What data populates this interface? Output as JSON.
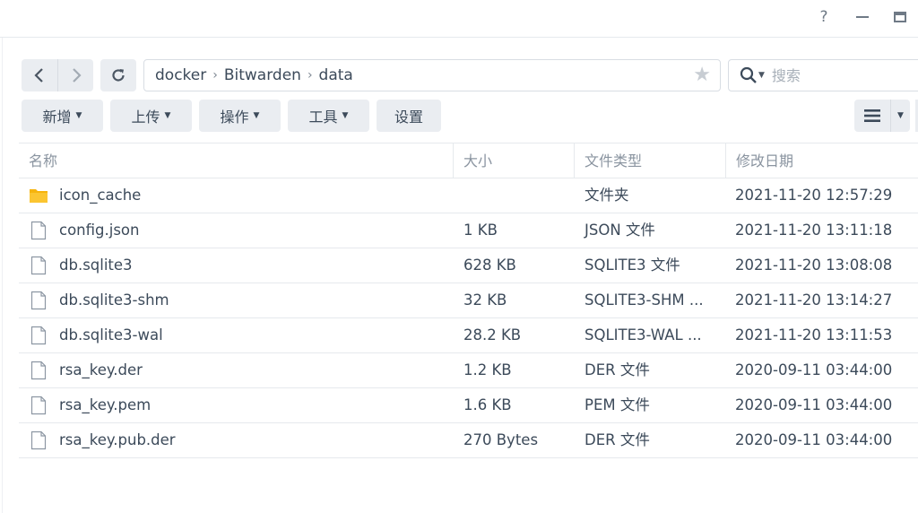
{
  "window": {
    "help_glyph": "?",
    "icons": [
      "help-icon",
      "minimize-icon",
      "maximize-icon"
    ]
  },
  "path": {
    "crumbs": [
      "docker",
      "Bitwarden",
      "data"
    ]
  },
  "search": {
    "placeholder": "搜索"
  },
  "actions": {
    "new_label": "新增",
    "upload_label": "上传",
    "operate_label": "操作",
    "tools_label": "工具",
    "settings_label": "设置"
  },
  "table": {
    "headers": [
      "名称",
      "大小",
      "文件类型",
      "修改日期"
    ],
    "rows": [
      {
        "icon": "folder-icon",
        "name": "icon_cache",
        "size": "",
        "type": "文件夹",
        "modified": "2021-11-20 12:57:29"
      },
      {
        "icon": "file-icon",
        "name": "config.json",
        "size": "1 KB",
        "type": "JSON 文件",
        "modified": "2021-11-20 13:11:18"
      },
      {
        "icon": "file-icon",
        "name": "db.sqlite3",
        "size": "628 KB",
        "type": "SQLITE3 文件",
        "modified": "2021-11-20 13:08:08"
      },
      {
        "icon": "file-icon",
        "name": "db.sqlite3-shm",
        "size": "32 KB",
        "type": "SQLITE3-SHM ...",
        "modified": "2021-11-20 13:14:27"
      },
      {
        "icon": "file-icon",
        "name": "db.sqlite3-wal",
        "size": "28.2 KB",
        "type": "SQLITE3-WAL ...",
        "modified": "2021-11-20 13:11:53"
      },
      {
        "icon": "file-icon",
        "name": "rsa_key.der",
        "size": "1.2 KB",
        "type": "DER 文件",
        "modified": "2020-09-11 03:44:00"
      },
      {
        "icon": "file-icon",
        "name": "rsa_key.pem",
        "size": "1.6 KB",
        "type": "PEM 文件",
        "modified": "2020-09-11 03:44:00"
      },
      {
        "icon": "file-icon",
        "name": "rsa_key.pub.der",
        "size": "270 Bytes",
        "type": "DER 文件",
        "modified": "2020-09-11 03:44:00"
      }
    ]
  },
  "colors": {
    "folder": "#f6b40e",
    "button_bg": "#eaedf1",
    "text": "#3c4a5a",
    "header_text": "#8a94a0",
    "star": "#c8cdd3"
  }
}
